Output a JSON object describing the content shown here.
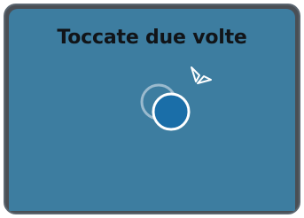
{
  "screen": {
    "title": "Toccate due volte",
    "icon": "double-tap-gesture-icon",
    "colors": {
      "panel": "#3d7da0",
      "tap_circle": "#1a6ea8",
      "ring": "#ffffff",
      "text": "#111418"
    }
  }
}
